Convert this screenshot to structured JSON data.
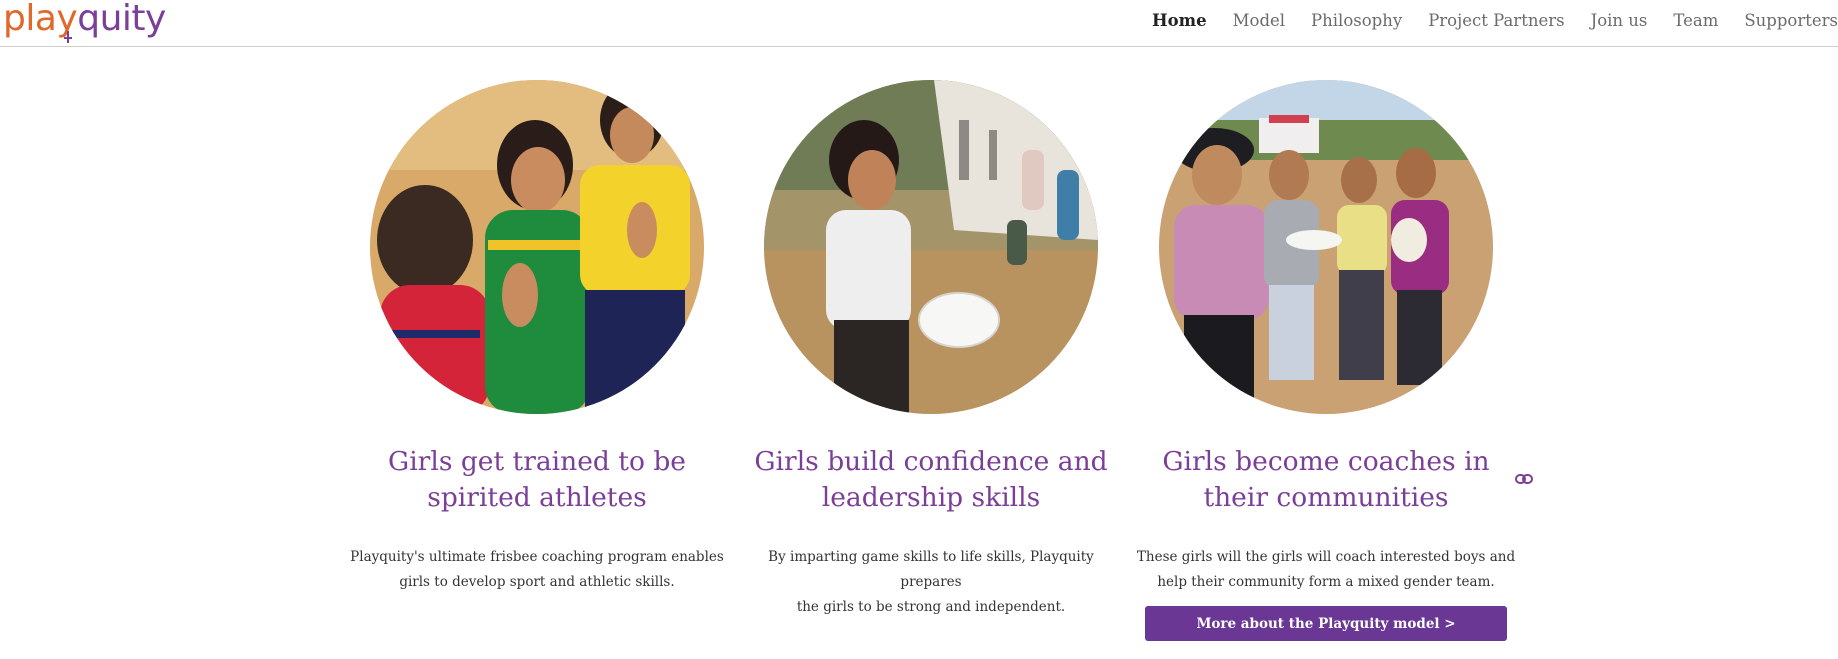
{
  "brand": {
    "logo_part1": "play",
    "logo_part2": "quity",
    "primary_color": "#7b3f98",
    "accent_color": "#e0682a",
    "button_color": "#6a3795"
  },
  "nav": {
    "items": [
      {
        "label": "Home",
        "active": true
      },
      {
        "label": "Model"
      },
      {
        "label": "Philosophy"
      },
      {
        "label": "Project Partners"
      },
      {
        "label": "Join us"
      },
      {
        "label": "Team"
      },
      {
        "label": "Supporters"
      }
    ]
  },
  "features": [
    {
      "title_line1": "Girls get trained to be",
      "title_line2": "spirited athletes",
      "text_line1": "Playquity's ultimate frisbee coaching program enables",
      "text_line2": "girls to develop sport and athletic skills.",
      "image": "photo of girls high-fiving"
    },
    {
      "title_line1": "Girls build confidence and",
      "title_line2": "leadership skills",
      "text_line1": "By imparting game skills to life skills, Playquity prepares",
      "text_line2": "the girls to be strong and independent.",
      "image": "photo of girl holding frisbee"
    },
    {
      "title_line1": "Girls become coaches in",
      "title_line2": "their communities",
      "text_line1": "These girls will the girls will coach interested boys and",
      "text_line2": "help their community form a mixed gender team.",
      "image": "photo of girls with a coach"
    }
  ],
  "cta": {
    "label": "More about the Playquity model >"
  },
  "icons": {
    "anchor": "link-icon"
  }
}
